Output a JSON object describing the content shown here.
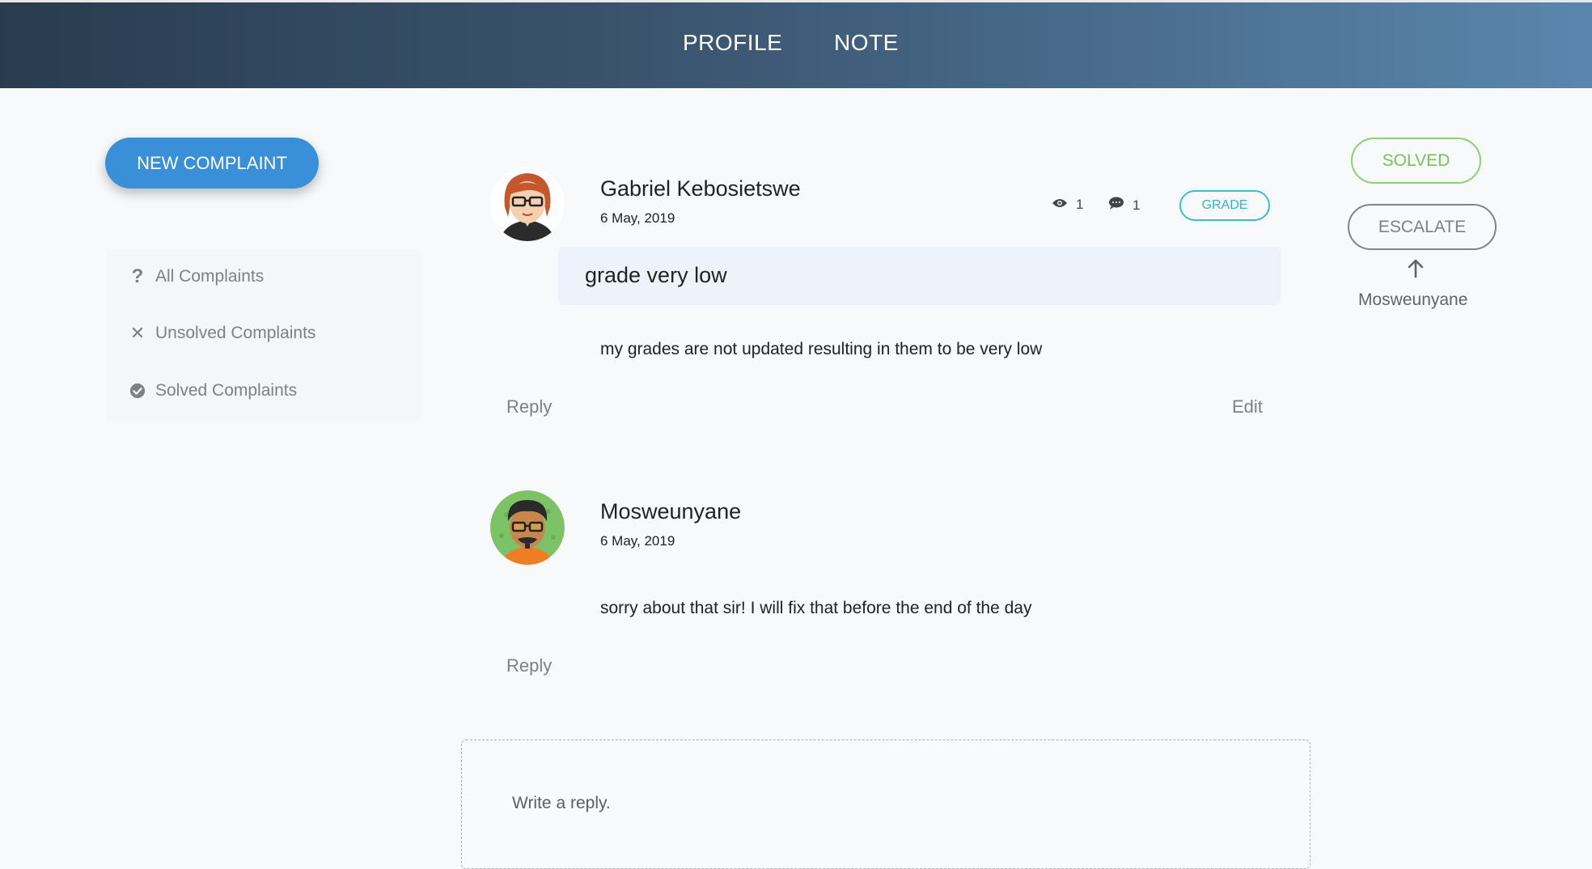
{
  "nav": {
    "profile": "PROFILE",
    "note": "NOTE"
  },
  "sidebar": {
    "new_complaint": "NEW COMPLAINT",
    "items": [
      {
        "label": "All Complaints",
        "icon": "question-icon"
      },
      {
        "label": "Unsolved Complaints",
        "icon": "close-icon"
      },
      {
        "label": "Solved Complaints",
        "icon": "check-circle-icon"
      }
    ]
  },
  "complaint": {
    "author": "Gabriel Kebosietswe",
    "date": "6 May, 2019",
    "views": "1",
    "comments": "1",
    "tag": "GRADE",
    "title": "grade very low",
    "body": "my grades are not updated resulting in them to be very low",
    "reply_label": "Reply",
    "edit_label": "Edit"
  },
  "reply": {
    "author": "Mosweunyane",
    "date": "6 May, 2019",
    "body": "sorry about that sir! I will fix that before the end of the day",
    "reply_label": "Reply"
  },
  "status": {
    "solved_label": "SOLVED",
    "escalate_label": "ESCALATE",
    "escalated_to": "Mosweunyane"
  },
  "reply_box": {
    "placeholder": "Write a reply."
  },
  "colors": {
    "primary": "#3a8fd9",
    "solved": "#76c35a",
    "tag": "#2fb6c7",
    "title_bg": "#edf3fb"
  }
}
